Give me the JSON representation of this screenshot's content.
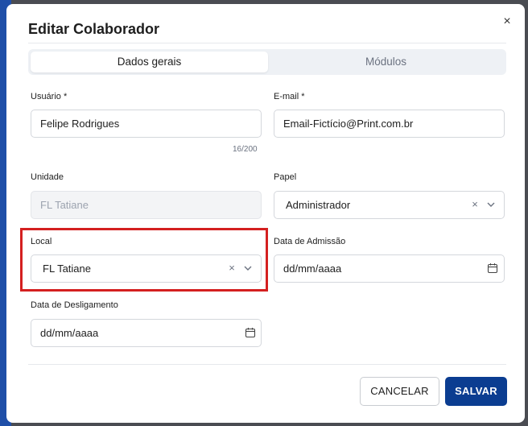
{
  "dialog": {
    "title": "Editar Colaborador",
    "close_glyph": "×"
  },
  "tabs": [
    {
      "label": "Dados gerais",
      "active": true
    },
    {
      "label": "Módulos",
      "active": false
    }
  ],
  "fields": {
    "usuario": {
      "label": "Usuário *",
      "value": "Felipe Rodrigues",
      "counter": "16/200"
    },
    "email": {
      "label": "E-mail *",
      "value": "Email-Fictício@Print.com.br"
    },
    "unidade": {
      "label": "Unidade",
      "value": "FL Tatiane",
      "disabled": true
    },
    "papel": {
      "label": "Papel",
      "value": "Administrador"
    },
    "local": {
      "label": "Local",
      "value": "FL Tatiane"
    },
    "data_admissao": {
      "label": "Data de Admissão",
      "placeholder": "dd/mm/aaaa"
    },
    "data_desligamento": {
      "label": "Data de Desligamento",
      "placeholder": "dd/mm/aaaa"
    }
  },
  "buttons": {
    "cancel": "CANCELAR",
    "save": "SALVAR"
  },
  "icons": {
    "clear": "clear-x-icon",
    "chevron": "chevron-down-icon",
    "calendar": "calendar-icon",
    "close": "close-icon"
  },
  "colors": {
    "primary": "#0b3d91",
    "highlight": "#d42020"
  }
}
